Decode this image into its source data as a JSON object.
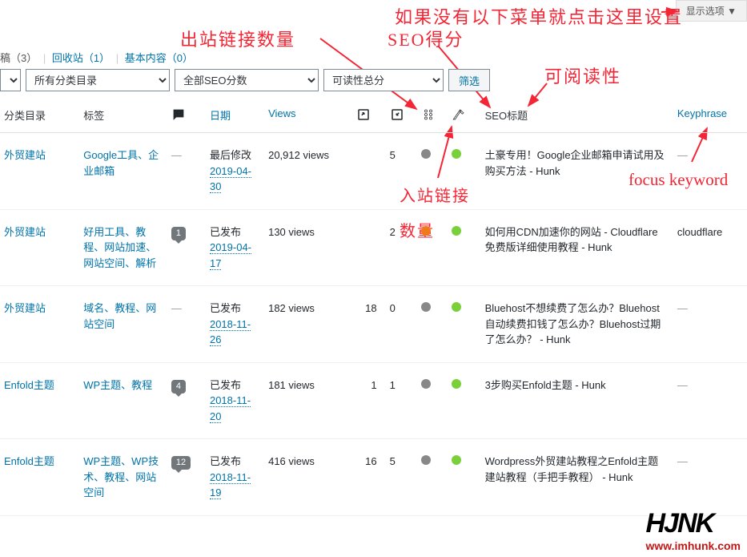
{
  "screen_options": "显示选项 ▼",
  "annotations": {
    "top_hint": "如果没有以下菜单就点击这里设置",
    "outbound": "出站链接数量",
    "seo_score": "SEO得分",
    "readability": "可阅读性",
    "inbound_l1": "入站链接",
    "inbound_l2": "数量",
    "focus_kw": "focus keyword"
  },
  "subsub": {
    "trash": "稿（3）",
    "recycle": "回收站（1）",
    "cornerstone": "基本内容（0）"
  },
  "filters": {
    "select1": "所有分类目录",
    "select2": "全部SEO分数",
    "select3": "可读性总分",
    "button": "筛选"
  },
  "headers": {
    "cat": "分类目录",
    "tag": "标签",
    "date": "日期",
    "views": "Views",
    "seo_title": "SEO标题",
    "keyphrase": "Keyphrase"
  },
  "rows": [
    {
      "cat": "外贸建站",
      "tags": "Google工具、企业邮箱",
      "comments": "—",
      "date_status": "最后修改",
      "date": "2019-04-30",
      "views": "20,912 views",
      "outbound": "",
      "inbound": "5",
      "score": "grey",
      "read": "green",
      "title": "土豪专用！Google企业邮箱申请试用及购买方法 - Hunk",
      "keyphrase": "—"
    },
    {
      "cat": "外贸建站",
      "tags": "好用工具、教程、网站加速、网站空间、解析",
      "comments": "1",
      "date_status": "已发布",
      "date": "2019-04-17",
      "views": "130 views",
      "outbound": "",
      "inbound": "2",
      "score": "orange",
      "read": "green",
      "title": "如何用CDN加速你的网站 - Cloudflare免费版详细使用教程 - Hunk",
      "keyphrase": "cloudflare"
    },
    {
      "cat": "外贸建站",
      "tags": "域名、教程、网站空间",
      "comments": "—",
      "date_status": "已发布",
      "date": "2018-11-26",
      "views": "182 views",
      "outbound": "18",
      "inbound": "0",
      "score": "grey",
      "read": "green",
      "title": "Bluehost不想续费了怎么办？Bluehost自动续费扣钱了怎么办？Bluehost过期了怎么办？ - Hunk",
      "keyphrase": "—"
    },
    {
      "cat": "Enfold主题",
      "tags": "WP主题、教程",
      "comments": "4",
      "date_status": "已发布",
      "date": "2018-11-20",
      "views": "181 views",
      "outbound": "1",
      "inbound": "1",
      "score": "grey",
      "read": "green",
      "title": "3步购买Enfold主题 - Hunk",
      "keyphrase": "—"
    },
    {
      "cat": "Enfold主题",
      "tags": "WP主题、WP技术、教程、网站空间",
      "comments": "12",
      "date_status": "已发布",
      "date": "2018-11-19",
      "views": "416 views",
      "outbound": "16",
      "inbound": "5",
      "score": "grey",
      "read": "green",
      "title": "Wordpress外贸建站教程之Enfold主题建站教程（手把手教程） - Hunk",
      "keyphrase": "—"
    }
  ],
  "watermark": {
    "logo": "HJNK",
    "url": "www.imhunk.com"
  }
}
